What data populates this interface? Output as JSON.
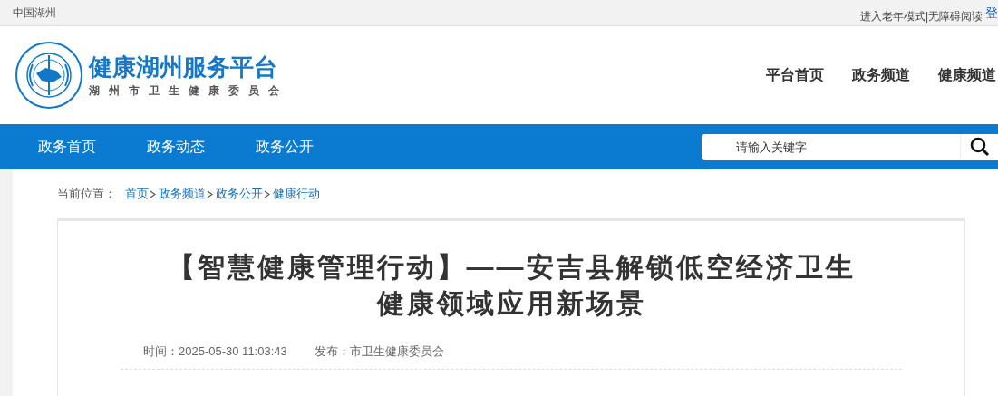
{
  "top_bar": {
    "region": "中国湖州",
    "links": [
      {
        "label": "进入老年模式|"
      },
      {
        "label": "无障碍阅读"
      }
    ],
    "login": "登"
  },
  "header": {
    "site_title": "健康湖州服务平台",
    "site_subtitle": "湖州市卫生健康委员会",
    "nav": [
      {
        "label": "平台首页"
      },
      {
        "label": "政务频道"
      },
      {
        "label": "健康频道"
      }
    ]
  },
  "channel_nav": {
    "items": [
      {
        "label": "政务首页"
      },
      {
        "label": "政务动态"
      },
      {
        "label": "政务公开"
      }
    ],
    "search": {
      "placeholder": "请输入关键字"
    }
  },
  "breadcrumb": {
    "label": "当前位置：",
    "items": [
      {
        "label": "首页"
      },
      {
        "label": "政务频道"
      },
      {
        "label": "政务公开"
      },
      {
        "label": "健康行动"
      }
    ]
  },
  "article": {
    "title_lines": [
      "【智慧健康管理行动】——安吉县解锁低空经济卫生",
      "健康领域应用新场景"
    ],
    "time": "时间：2025-05-30 11:03:43",
    "publisher": "发布：市卫生健康委员会"
  }
}
